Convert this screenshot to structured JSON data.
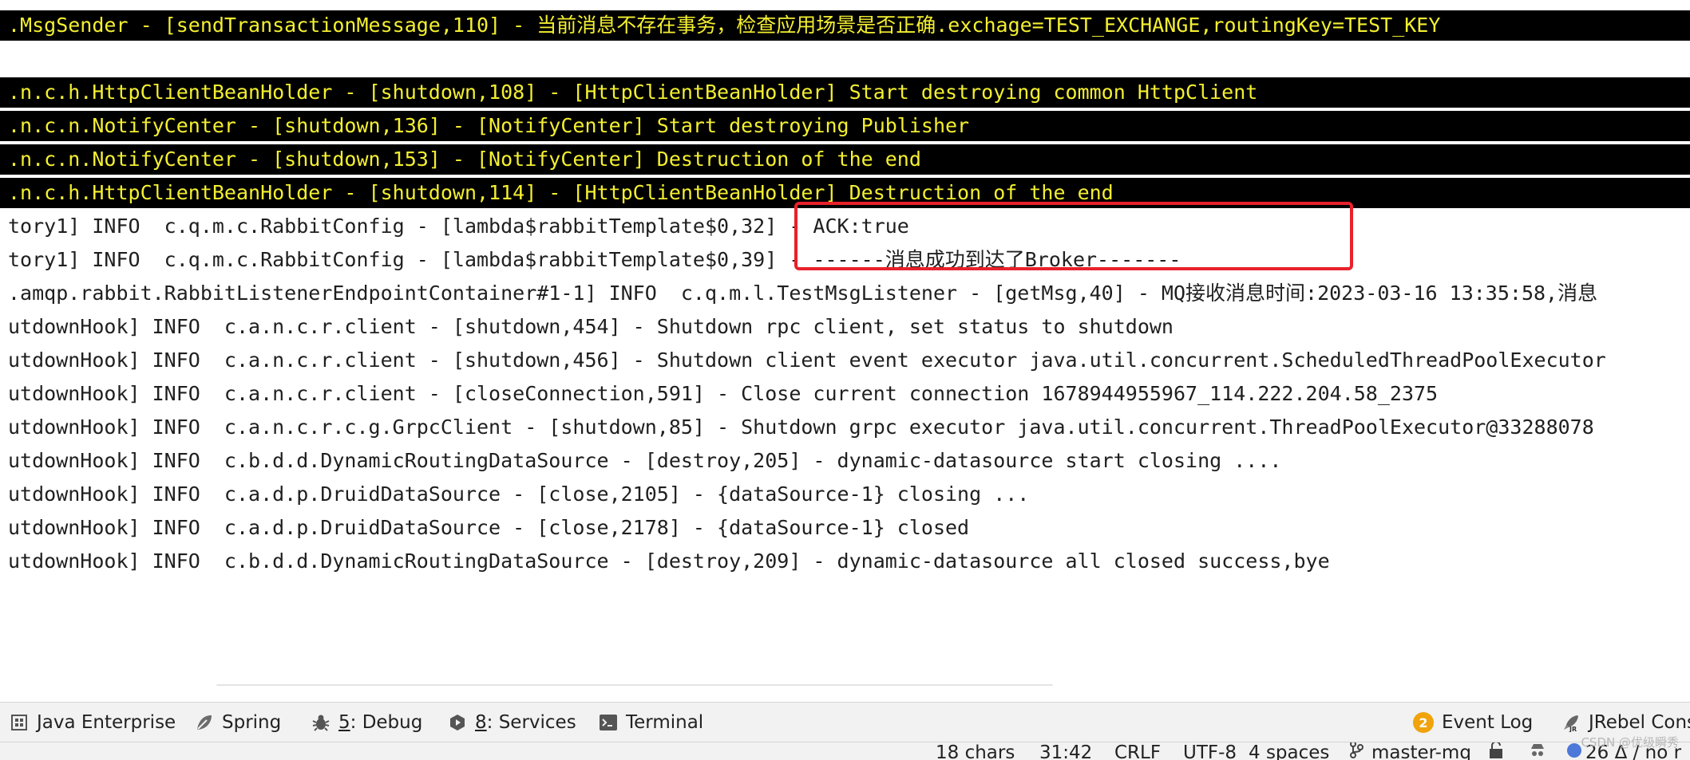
{
  "console": {
    "lines": [
      {
        "text": ".MsgSender - [sendTransactionMessage,110] - 当前消息不存在事务，检查应用场景是否正确.exchage=TEST_EXCHANGE,routingKey=TEST_KEY",
        "highlight": true
      },
      {
        "text": ".n.c.h.HttpClientBeanHolder - [shutdown,108] - [HttpClientBeanHolder] Start destroying common HttpClient",
        "highlight": true
      },
      {
        "text": ".n.c.n.NotifyCenter - [shutdown,136] - [NotifyCenter] Start destroying Publisher",
        "highlight": true
      },
      {
        "text": ".n.c.n.NotifyCenter - [shutdown,153] - [NotifyCenter] Destruction of the end",
        "highlight": true
      },
      {
        "text": ".n.c.h.HttpClientBeanHolder - [shutdown,114] - [HttpClientBeanHolder] Destruction of the end",
        "highlight": true
      },
      {
        "text": "tory1] INFO  c.q.m.c.RabbitConfig - [lambda$rabbitTemplate$0,32] - ACK:true",
        "highlight": false
      },
      {
        "text": "tory1] INFO  c.q.m.c.RabbitConfig - [lambda$rabbitTemplate$0,39] - ------消息成功到达了Broker-------",
        "highlight": false
      },
      {
        "text": ".amqp.rabbit.RabbitListenerEndpointContainer#1-1] INFO  c.q.m.l.TestMsgListener - [getMsg,40] - MQ接收消息时间:2023-03-16 13:35:58,消息",
        "highlight": false
      },
      {
        "text": "utdownHook] INFO  c.a.n.c.r.client - [shutdown,454] - Shutdown rpc client, set status to shutdown",
        "highlight": false
      },
      {
        "text": "utdownHook] INFO  c.a.n.c.r.client - [shutdown,456] - Shutdown client event executor java.util.concurrent.ScheduledThreadPoolExecutor",
        "highlight": false
      },
      {
        "text": "utdownHook] INFO  c.a.n.c.r.client - [closeConnection,591] - Close current connection 1678944955967_114.222.204.58_2375",
        "highlight": false
      },
      {
        "text": "utdownHook] INFO  c.a.n.c.r.c.g.GrpcClient - [shutdown,85] - Shutdown grpc executor java.util.concurrent.ThreadPoolExecutor@33288078",
        "highlight": false
      },
      {
        "text": "utdownHook] INFO  c.b.d.d.DynamicRoutingDataSource - [destroy,205] - dynamic-datasource start closing ....",
        "highlight": false
      },
      {
        "text": "utdownHook] INFO  c.a.d.p.DruidDataSource - [close,2105] - {dataSource-1} closing ...",
        "highlight": false
      },
      {
        "text": "utdownHook] INFO  c.a.d.p.DruidDataSource - [close,2178] - {dataSource-1} closed",
        "highlight": false
      },
      {
        "text": "utdownHook] INFO  c.b.d.d.DynamicRoutingDataSource - [destroy,209] - dynamic-datasource all closed success,bye",
        "highlight": false
      }
    ]
  },
  "tool_windows": {
    "java_enterprise": "Java Enterprise",
    "spring": "Spring",
    "debug_num": "5",
    "debug": ": Debug",
    "services_num": "8",
    "services": ": Services",
    "terminal": "Terminal",
    "event_log_count": "2",
    "event_log": "Event Log",
    "jrebel": "JRebel Cons"
  },
  "status_bar": {
    "chars": "18 chars",
    "position": "31:42",
    "line_separator": "CRLF",
    "encoding": "UTF-8",
    "indent": "4 spaces",
    "branch": "master-mq",
    "changes": "26 Δ / no r"
  },
  "watermark": "CSDN @优级瞬秀",
  "colors": {
    "highlight_bg": "#000000",
    "highlight_fg": "#f3ef30",
    "annotation_box": "#e8212b"
  }
}
